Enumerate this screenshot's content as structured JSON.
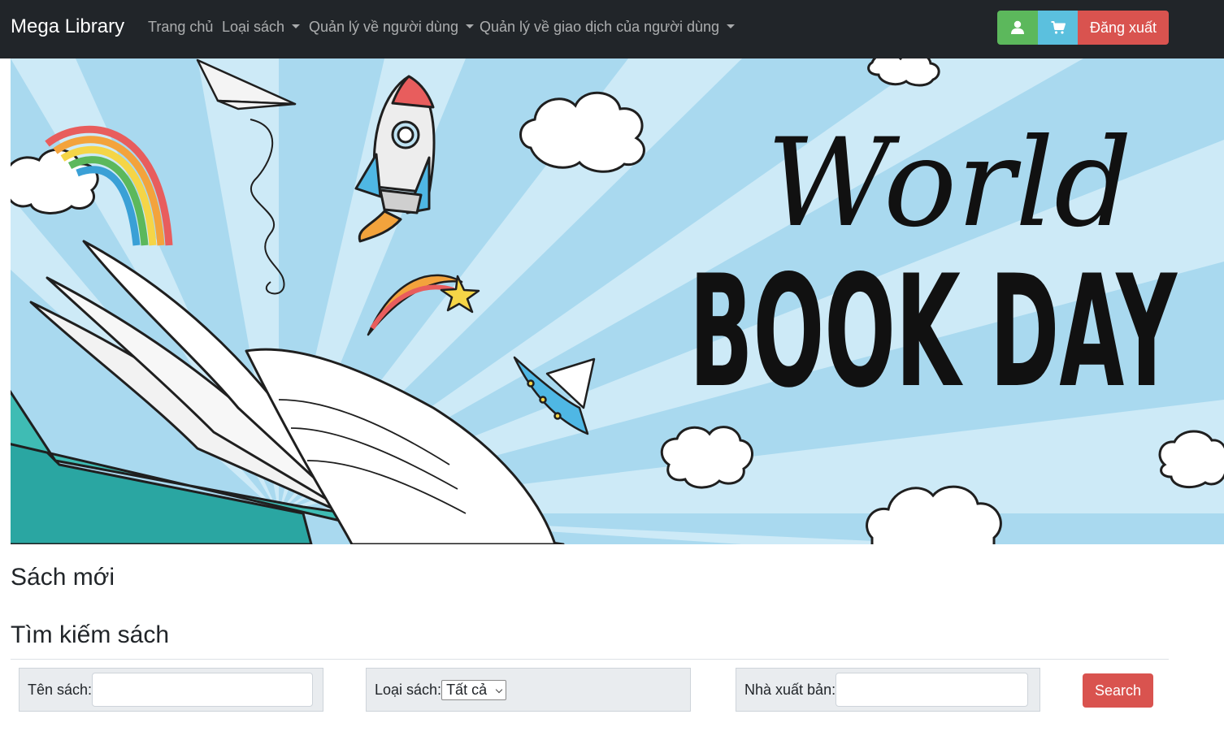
{
  "navbar": {
    "brand": "Mega Library",
    "links": [
      {
        "label": "Trang chủ",
        "has_dropdown": false
      },
      {
        "label": "Loại sách",
        "has_dropdown": true
      },
      {
        "label": "Quản lý về người dùng",
        "has_dropdown": true
      },
      {
        "label": "Quản lý về giao dịch của người dùng",
        "has_dropdown": true
      }
    ],
    "buttons": {
      "user_icon": "user-icon",
      "cart_icon": "cart-icon",
      "logout_label": "Đăng xuất"
    }
  },
  "banner": {
    "line1": "World",
    "line2": "BOOK DAY"
  },
  "sections": {
    "new_books": "Sách mới",
    "search_books": "Tìm kiếm sách"
  },
  "search_form": {
    "title_label": "Tên sách:",
    "title_value": "",
    "category_label": "Loại sách:",
    "category_selected": "Tất cả",
    "publisher_label": "Nhà xuất bản:",
    "publisher_value": "",
    "submit_label": "Search"
  },
  "colors": {
    "navbar_bg": "#212529",
    "user_button": "#5cb85c",
    "cart_button": "#5bc0de",
    "logout_button": "#d9534f",
    "search_button": "#d9534f",
    "banner_sky": "#a9d9ef"
  }
}
